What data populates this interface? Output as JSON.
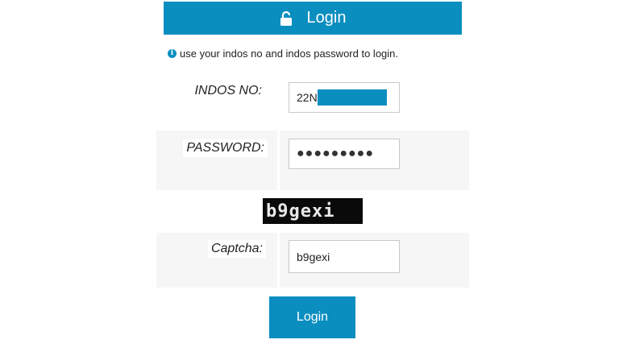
{
  "header": {
    "title": "Login",
    "icon": "unlock-icon"
  },
  "info": {
    "icon": "info-icon",
    "text": "use your indos no and indos password to login."
  },
  "form": {
    "indos": {
      "label": "INDOS NO:",
      "value_visible": "22N"
    },
    "password": {
      "label": "PASSWORD:",
      "value_masked": "●●●●●●●●●"
    },
    "captcha_image_text": "b9gexi",
    "captcha": {
      "label": "Captcha:",
      "value": "b9gexi"
    },
    "submit_label": "Login"
  },
  "colors": {
    "accent": "#0a8ec0",
    "row_shade": "#f6f6f6"
  }
}
